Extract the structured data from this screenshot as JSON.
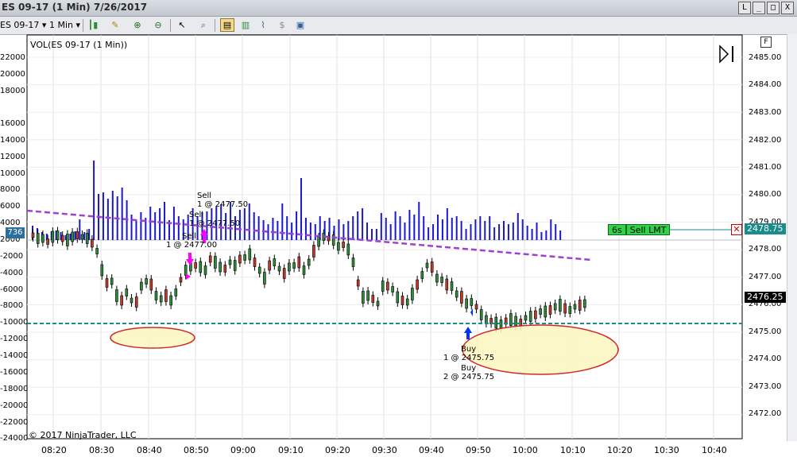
{
  "window": {
    "title": "ES 09-17 (1 Min)  7/26/2017",
    "buttons": [
      "L",
      "_",
      "□",
      "X"
    ]
  },
  "toolbar": {
    "instrument": "ES 09-17",
    "interval": "1 Min",
    "icons": [
      "candle-style-icon",
      "pencil-icon",
      "zoom-in-icon",
      "zoom-out-icon",
      "cursor-icon",
      "magnifier-icon",
      "chart-trader-icon",
      "bar-chart-icon",
      "indicator-icon",
      "strategy-icon",
      "properties-icon"
    ]
  },
  "chart": {
    "panel_label": "VOL(ES 09-17 (1 Min))",
    "copyright": "© 2017 NinjaTrader, LLC",
    "f_button": "F",
    "left_axis": [
      "22000",
      "20000",
      "18000",
      "16000",
      "14000",
      "12000",
      "10000",
      "8000",
      "6000",
      "4000",
      "2000",
      "0",
      "-2000",
      "-4000",
      "-6000",
      "-8000",
      "-10000",
      "-12000",
      "-14000",
      "-16000",
      "-18000",
      "-20000",
      "-22000",
      "-24000"
    ],
    "right_axis": [
      "2485.00",
      "2484.00",
      "2483.00",
      "2482.00",
      "2481.00",
      "2480.00",
      "2479.00",
      "2478.00",
      "2477.00",
      "2476.00",
      "2475.00",
      "2474.00",
      "2473.00",
      "2472.00"
    ],
    "x_axis": [
      "08:20",
      "08:30",
      "08:40",
      "08:50",
      "09:00",
      "09:10",
      "09:20",
      "09:30",
      "09:40",
      "09:50",
      "10:00",
      "10:10",
      "10:20",
      "10:30",
      "10:40"
    ],
    "volume_tag": "736",
    "last_price": "2476.25",
    "order_price": "2478.75",
    "order_timer": "6s",
    "order_label": "Sell LMT"
  },
  "annotations": {
    "sell1": [
      "Sell",
      "1 @ 2477.50"
    ],
    "sell2": [
      "Sell",
      "1 @ 2477.50"
    ],
    "sell3": [
      "Sell",
      "1 @ 2477.00"
    ],
    "buy1": [
      "Buy",
      "1 @ 2475.75"
    ],
    "buy2": [
      "Buy",
      "2 @ 2475.75"
    ]
  },
  "colors": {
    "volume_bar": "#1a1acc",
    "up_candle": "#2e8b3a",
    "down_candle": "#c0392b",
    "trendline": "#a040d0",
    "support_line": "#1a8c8c",
    "ellipse_fill": "#fbf6c0",
    "ellipse_stroke": "#d02828",
    "marker_sell": "#ff00ff",
    "marker_buy": "#0033ff"
  }
}
